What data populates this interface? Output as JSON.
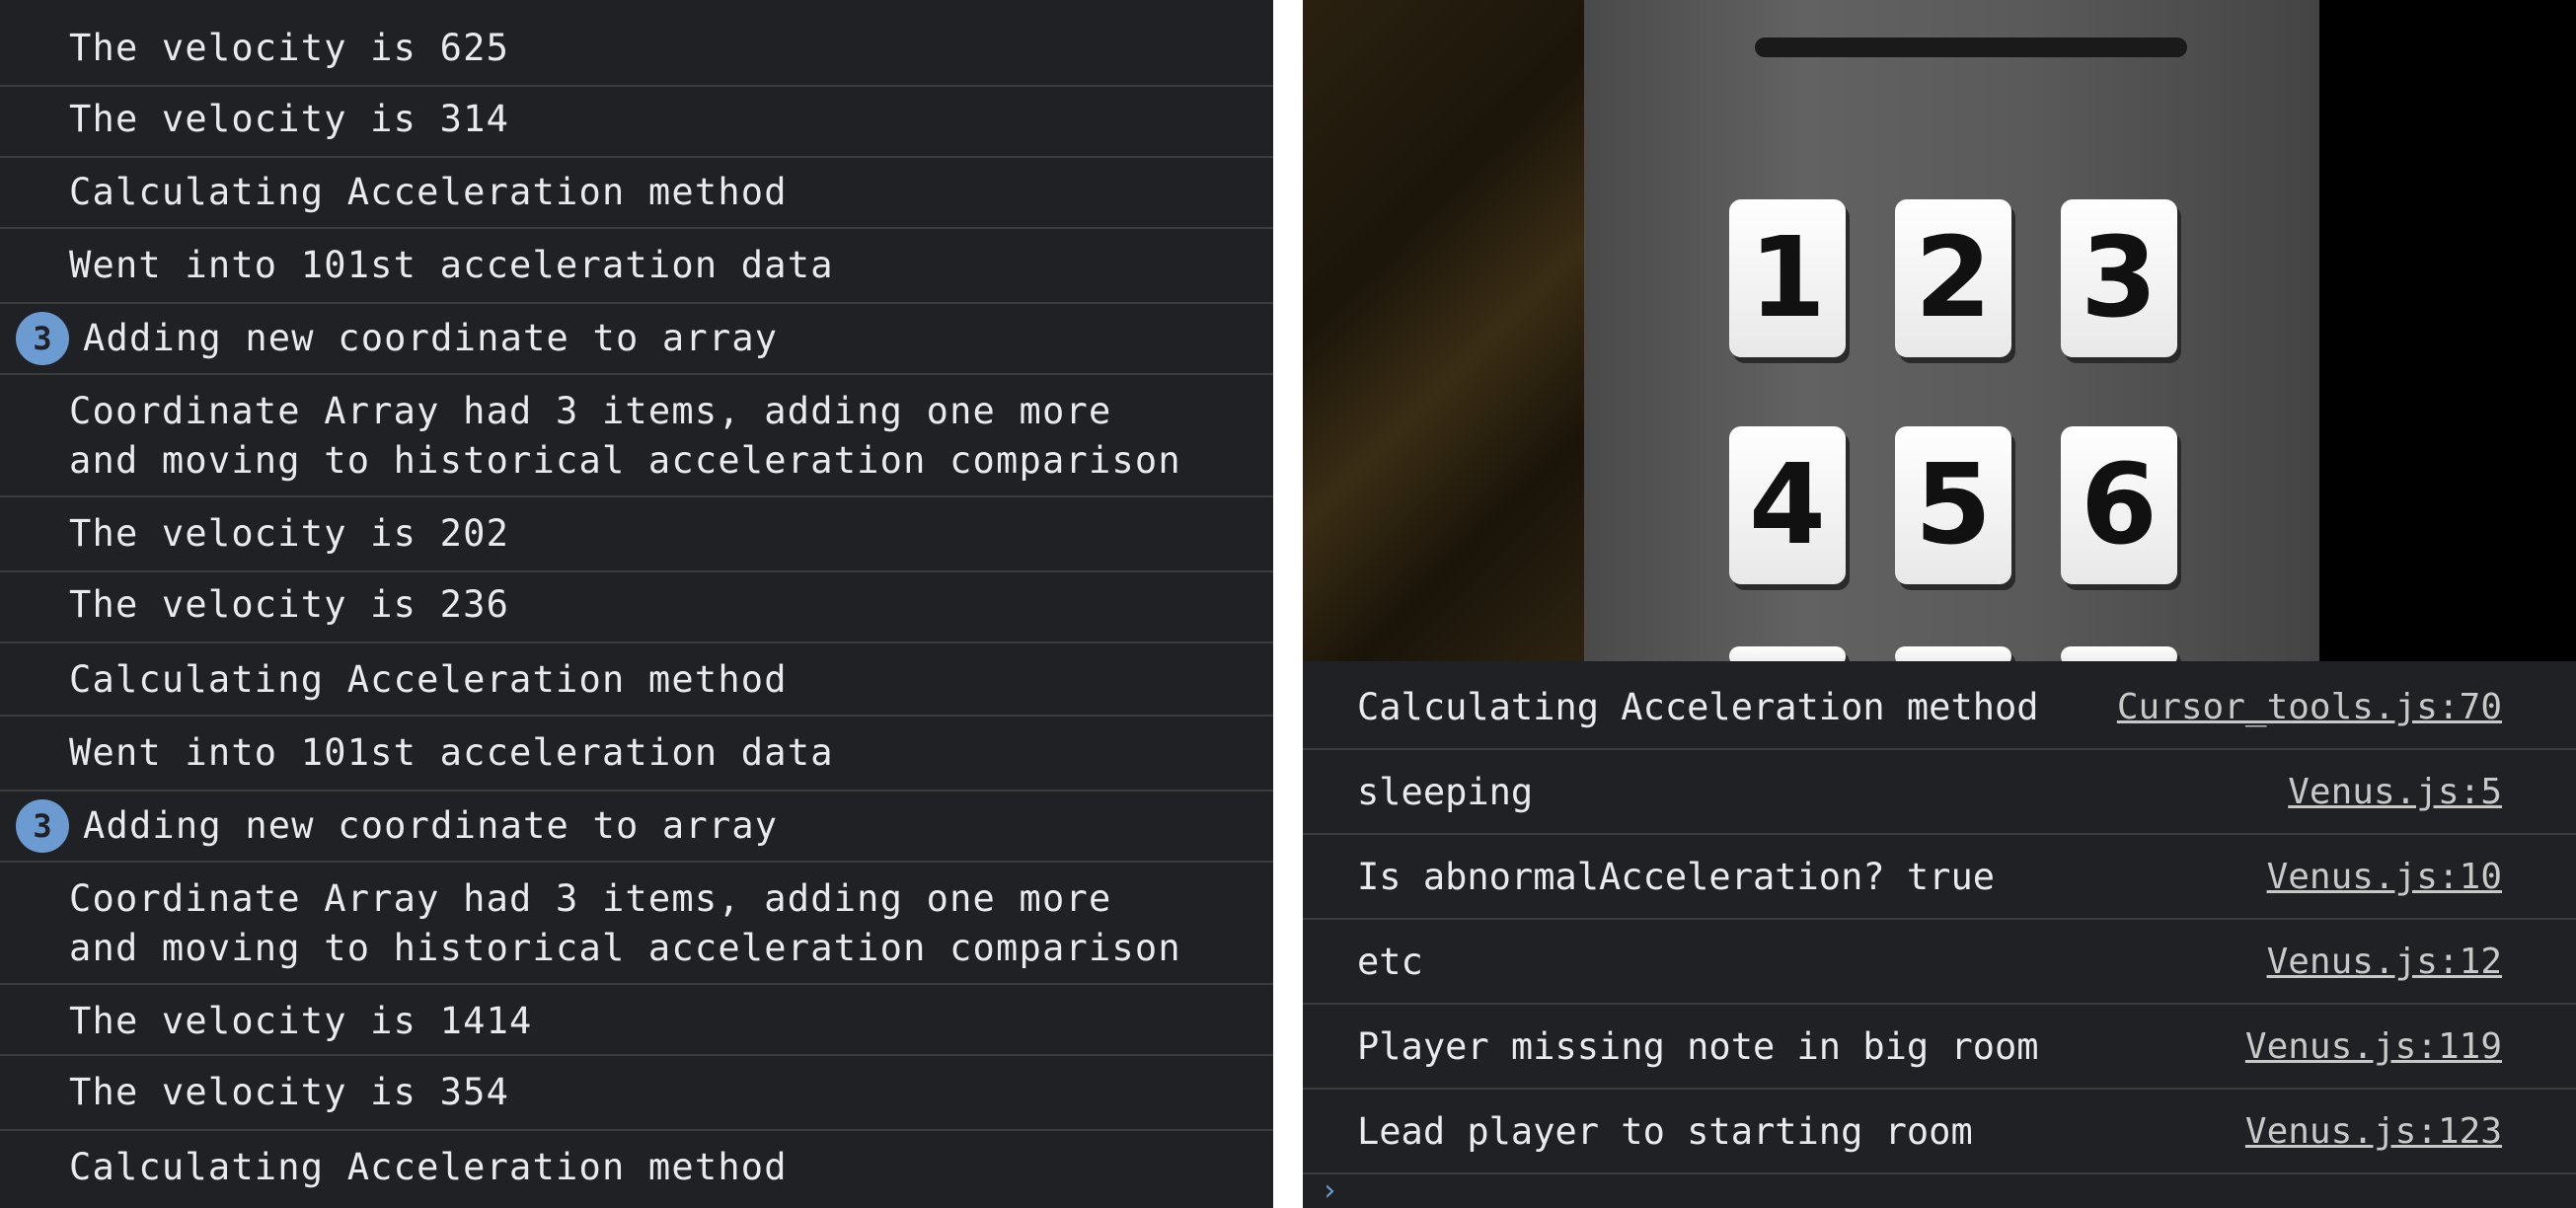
{
  "left_console": {
    "rows": [
      {
        "text": "The velocity is 625"
      },
      {
        "text": "The velocity is 314"
      },
      {
        "text": "Calculating Acceleration method"
      },
      {
        "text": "Went into 101st acceleration data"
      },
      {
        "text": "Adding new coordinate to array",
        "badge": "3"
      },
      {
        "text": "Coordinate Array had 3 items, adding one more\nand moving to historical acceleration comparison"
      },
      {
        "text": "The velocity is 202"
      },
      {
        "text": "The velocity is 236"
      },
      {
        "text": "Calculating Acceleration method"
      },
      {
        "text": "Went into 101st acceleration data"
      },
      {
        "text": "Adding new coordinate to array",
        "badge": "3"
      },
      {
        "text": "Coordinate Array had 3 items, adding one more\nand moving to historical acceleration comparison"
      },
      {
        "text": "The velocity is 1414"
      },
      {
        "text": "The velocity is 354"
      },
      {
        "text": "Calculating Acceleration method"
      }
    ]
  },
  "game_view": {
    "keys": [
      "1",
      "2",
      "3",
      "4",
      "5",
      "6"
    ]
  },
  "right_console": {
    "rows": [
      {
        "text": "Calculating Acceleration method",
        "source": "Cursor_tools.js:70"
      },
      {
        "text": "sleeping",
        "source": "Venus.js:5"
      },
      {
        "text": "Is abnormalAcceleration? true",
        "source": "Venus.js:10"
      },
      {
        "text": "etc",
        "source": "Venus.js:12"
      },
      {
        "text": "Player missing note in big room",
        "source": "Venus.js:119"
      },
      {
        "text": "Lead player to starting room",
        "source": "Venus.js:123"
      }
    ],
    "prompt_icon": "chevron-right-icon"
  },
  "colors": {
    "console_bg": "#202124",
    "console_text": "#e8eaed",
    "row_border": "#3c3c3c",
    "badge_bg": "#6b9bd1"
  }
}
